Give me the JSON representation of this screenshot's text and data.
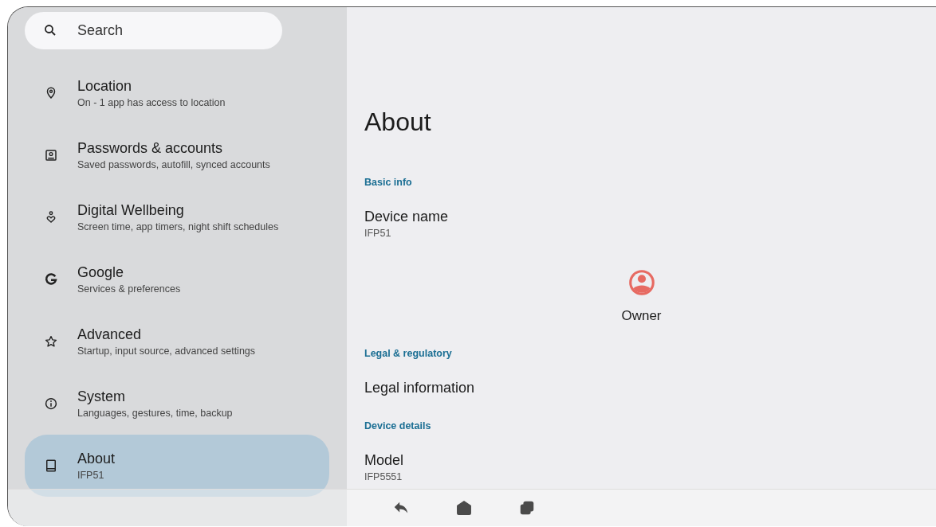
{
  "search": {
    "placeholder": "Search"
  },
  "sidebar": {
    "items": [
      {
        "kind": "location",
        "title": "Location",
        "subtitle": "On - 1 app has access to location",
        "selected": false
      },
      {
        "kind": "account",
        "title": "Passwords & accounts",
        "subtitle": "Saved passwords, autofill, synced accounts",
        "selected": false
      },
      {
        "kind": "wellbeing",
        "title": "Digital Wellbeing",
        "subtitle": "Screen time, app timers, night shift schedules",
        "selected": false
      },
      {
        "kind": "google",
        "title": "Google",
        "subtitle": "Services & preferences",
        "selected": false
      },
      {
        "kind": "star",
        "title": "Advanced",
        "subtitle": "Startup, input source, advanced settings",
        "selected": false
      },
      {
        "kind": "info",
        "title": "System",
        "subtitle": "Languages, gestures, time, backup",
        "selected": false
      },
      {
        "kind": "device",
        "title": "About",
        "subtitle": "IFP51",
        "selected": true
      }
    ]
  },
  "page": {
    "title": "About",
    "sections": [
      {
        "heading": "Basic info",
        "items": [
          {
            "kind": "setting",
            "name": "Device name",
            "value": "IFP51"
          },
          {
            "kind": "profile",
            "name": "Owner"
          }
        ]
      },
      {
        "heading": "Legal & regulatory",
        "items": [
          {
            "kind": "setting",
            "name": "Legal information"
          }
        ]
      },
      {
        "heading": "Device details",
        "items": [
          {
            "kind": "setting",
            "name": "Model",
            "value": "IFP5551"
          }
        ]
      }
    ]
  },
  "nav_bar": [
    {
      "kind": "back"
    },
    {
      "kind": "home"
    },
    {
      "kind": "recents"
    }
  ]
}
